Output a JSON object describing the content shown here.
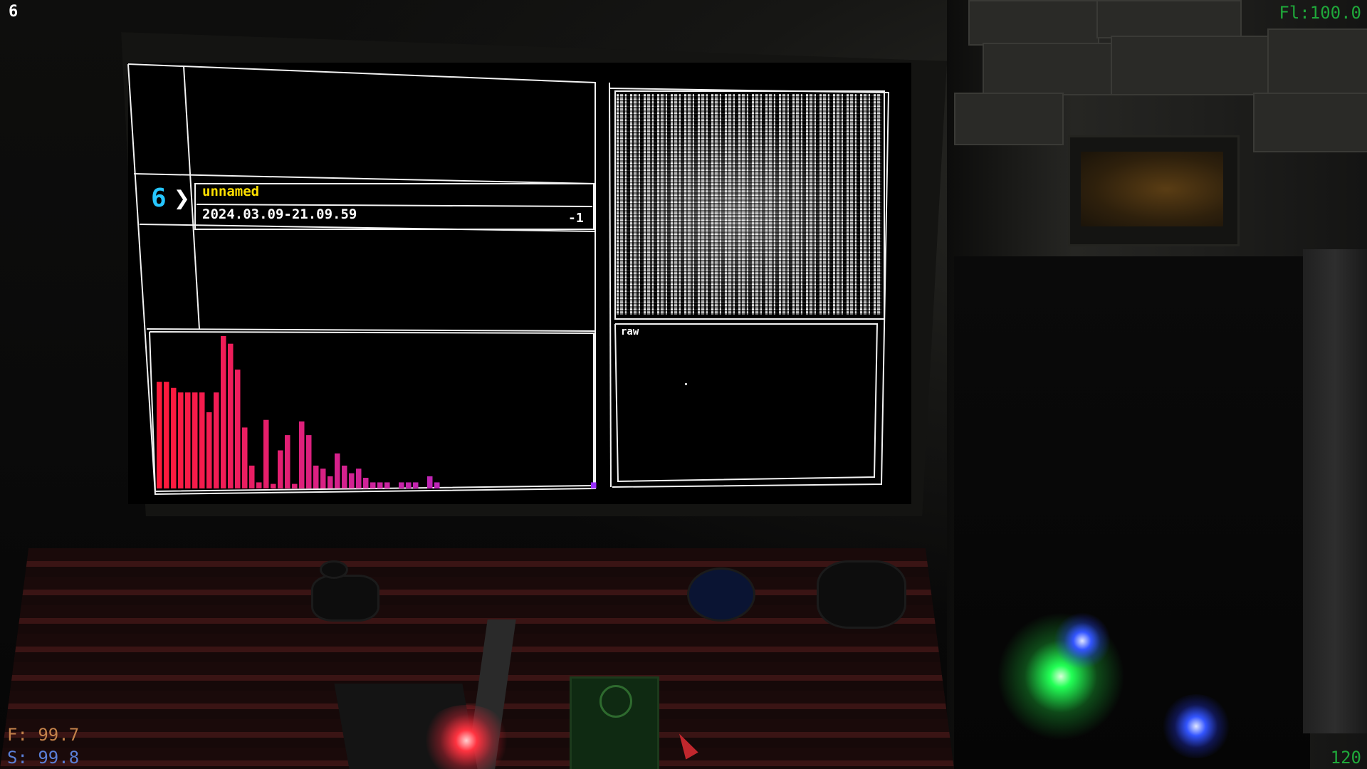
{
  "hud": {
    "top_left": "6",
    "top_right": "Fl:100.0",
    "bottom_left_f": "F: 99.7",
    "bottom_left_s": "S: 99.8",
    "bottom_right": "120"
  },
  "colors": {
    "hud_green": "#1fa83a",
    "hud_orange": "#c4824a",
    "hud_blue": "#5a7fd6",
    "track_name": "#ffe000",
    "slot_number": "#26c6ff"
  },
  "terminal": {
    "slot_number": "6",
    "arrow_icon": "chevron-right-icon",
    "track_name": "unnamed",
    "track_date": "2024.03.09-21.09.59",
    "track_value": "-1",
    "preview_label": "raw"
  },
  "chart_data": {
    "type": "bar",
    "values": [
      70,
      70,
      66,
      63,
      63,
      63,
      63,
      50,
      63,
      100,
      95,
      78,
      40,
      15,
      4,
      45,
      3,
      25,
      35,
      3,
      44,
      35,
      15,
      13,
      8,
      23,
      15,
      10,
      13,
      7,
      4,
      4,
      4,
      0,
      4,
      4,
      4,
      0,
      8,
      4,
      0,
      0,
      0,
      0,
      0,
      0,
      0,
      0,
      0,
      0,
      0,
      0,
      0,
      0,
      0,
      0,
      0,
      0,
      0,
      0,
      0,
      4
    ],
    "ylim": [
      0,
      100
    ],
    "colors": {
      "start": "#ff1a3a",
      "end": "#9a2cff"
    }
  },
  "icons": {
    "led_red": "#ff3340",
    "led_green": "#22ff55",
    "led_blue": "#3355ff"
  }
}
